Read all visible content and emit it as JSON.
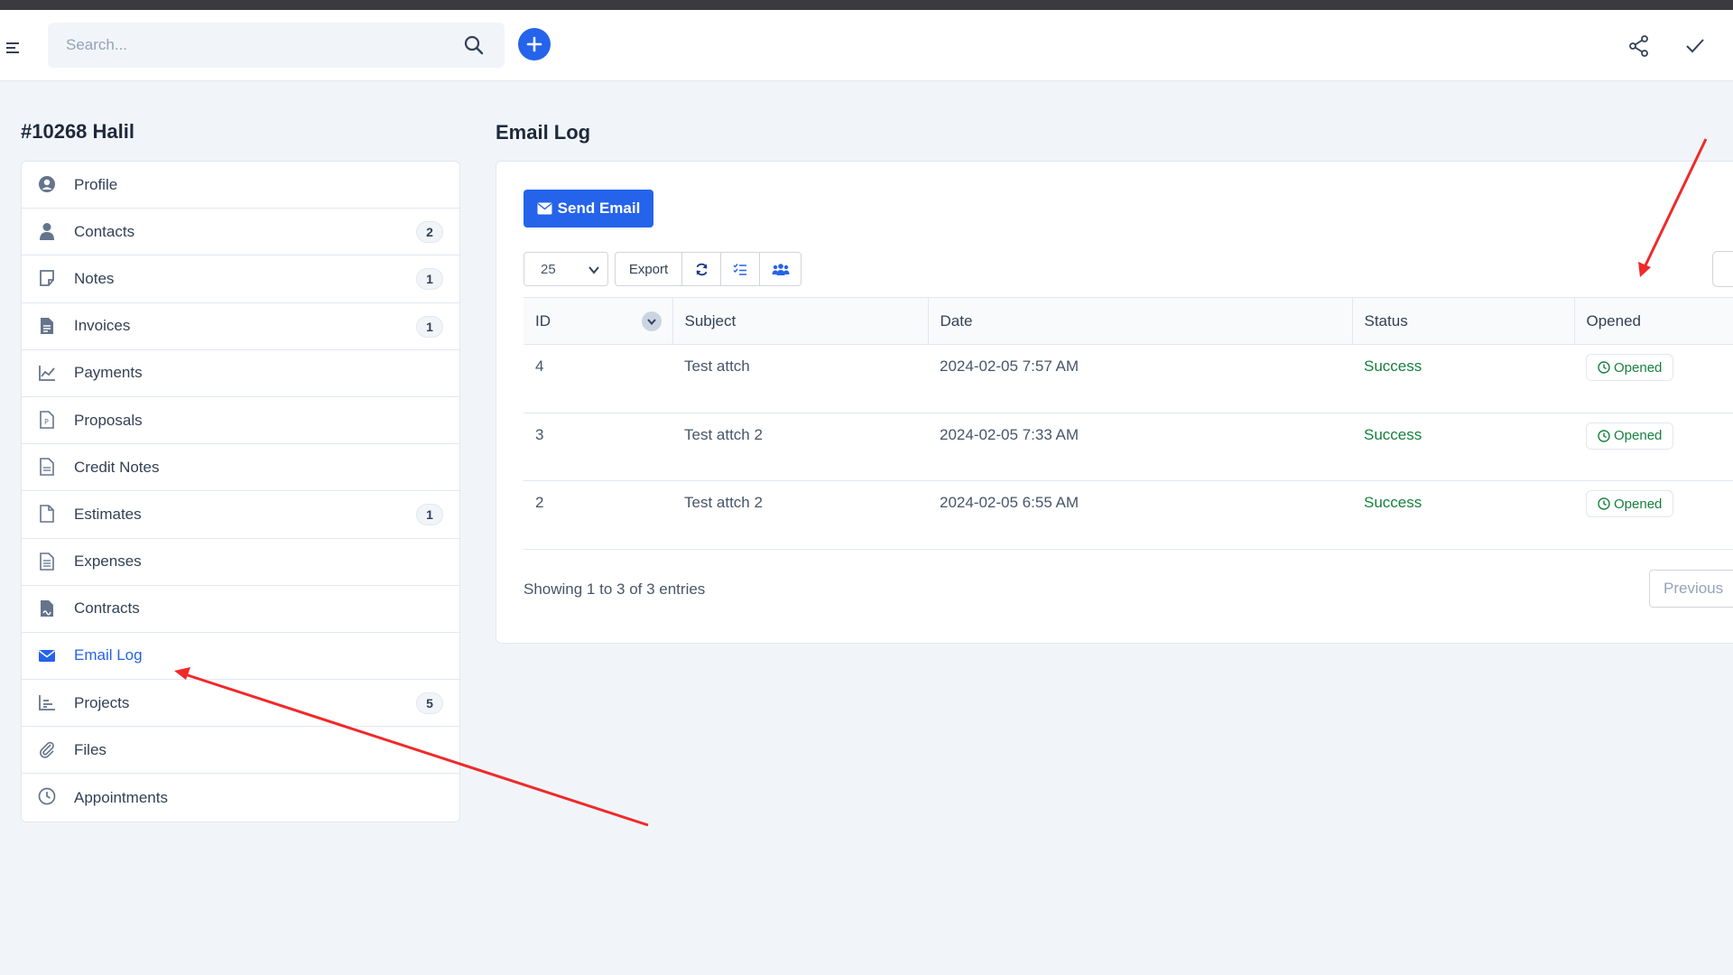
{
  "topbar": {
    "search_placeholder": "Search...",
    "icons": [
      "menu-icon",
      "search-icon",
      "plus-icon",
      "share-icon",
      "check-icon"
    ],
    "accent": "#2563eb"
  },
  "customer": {
    "title": "#10268 Halil"
  },
  "sidebar": {
    "items": [
      {
        "label": "Profile",
        "badge": "",
        "icon": "user-circle-icon"
      },
      {
        "label": "Contacts",
        "badge": "2",
        "icon": "user-icon"
      },
      {
        "label": "Notes",
        "badge": "1",
        "icon": "note-icon"
      },
      {
        "label": "Invoices",
        "badge": "1",
        "icon": "invoice-icon"
      },
      {
        "label": "Payments",
        "badge": "",
        "icon": "line-chart-icon"
      },
      {
        "label": "Proposals",
        "badge": "",
        "icon": "proposal-icon"
      },
      {
        "label": "Credit Notes",
        "badge": "",
        "icon": "document-icon"
      },
      {
        "label": "Estimates",
        "badge": "1",
        "icon": "file-icon"
      },
      {
        "label": "Expenses",
        "badge": "",
        "icon": "file-lines-icon"
      },
      {
        "label": "Contracts",
        "badge": "",
        "icon": "contract-icon"
      },
      {
        "label": "Email Log",
        "badge": "",
        "icon": "envelope-icon",
        "active": true
      },
      {
        "label": "Projects",
        "badge": "5",
        "icon": "bar-chart-icon"
      },
      {
        "label": "Files",
        "badge": "",
        "icon": "paperclip-icon"
      },
      {
        "label": "Appointments",
        "badge": "",
        "icon": "clock-icon"
      }
    ]
  },
  "main": {
    "title": "Email Log",
    "send_button": "Send Email",
    "page_length": "25",
    "export_label": "Export",
    "table": {
      "columns": [
        "ID",
        "Subject",
        "Date",
        "Status",
        "Opened"
      ],
      "rows": [
        {
          "id": "4",
          "subject": "Test attch",
          "date": "2024-02-05 7:57 AM",
          "status": "Success",
          "opened": "Opened"
        },
        {
          "id": "3",
          "subject": "Test attch 2",
          "date": "2024-02-05 7:33 AM",
          "status": "Success",
          "opened": "Opened"
        },
        {
          "id": "2",
          "subject": "Test attch 2",
          "date": "2024-02-05 6:55 AM",
          "status": "Success",
          "opened": "Opened"
        }
      ]
    },
    "info": "Showing 1 to 3 of 3 entries",
    "previous": "Previous"
  },
  "colors": {
    "status_success": "#15803d",
    "annotation_arrow": "#ef2a2a"
  }
}
